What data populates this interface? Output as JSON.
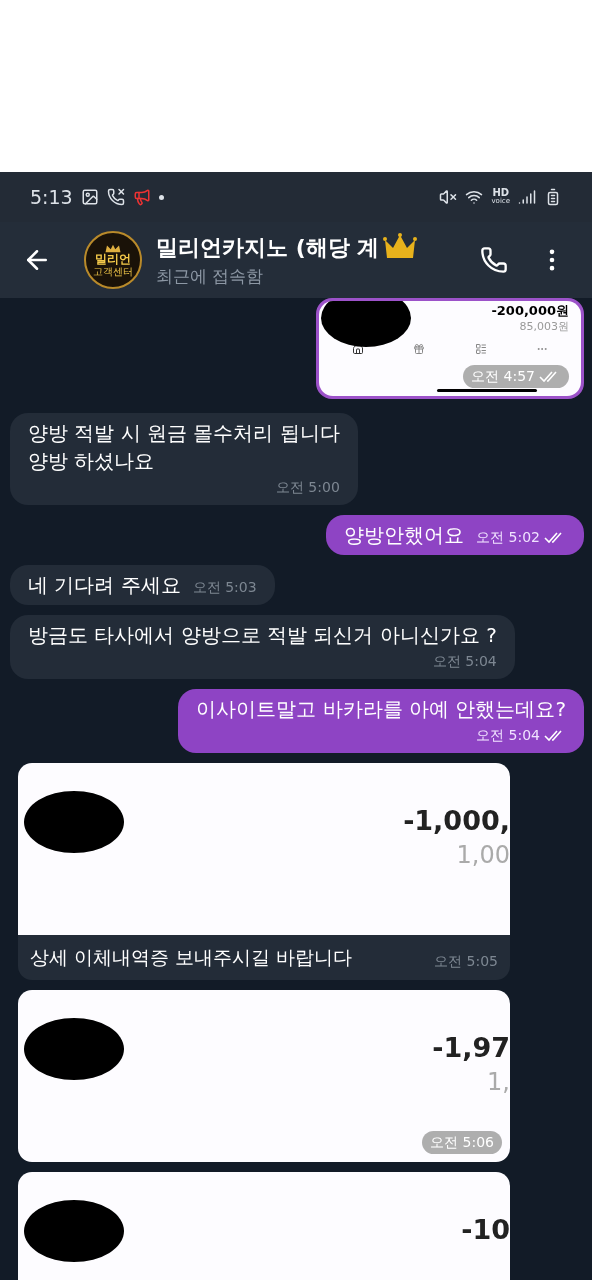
{
  "status_bar": {
    "time": "5:13",
    "hd": "HD",
    "voice": "voice"
  },
  "header": {
    "avatar": {
      "line1": "밀리언",
      "line2": "고객센터"
    },
    "title": "밀리언카지노 (해당 계",
    "subtitle": "최근에 접속함"
  },
  "messages": [
    {
      "kind": "image",
      "outgoing": true,
      "read": true,
      "time": "오전 4:57",
      "amount": "-200,000원",
      "balance": "85,003원",
      "nav": true
    },
    {
      "kind": "text",
      "outgoing": false,
      "lines": [
        "양방 적발 시 원금 몰수처리 됩니다",
        "양방 하셨나요"
      ],
      "time": "오전 5:00"
    },
    {
      "kind": "text",
      "outgoing": true,
      "read": true,
      "lines": [
        "양방안했어요"
      ],
      "time": "오전 5:02"
    },
    {
      "kind": "text",
      "outgoing": false,
      "lines": [
        "네 기다려 주세요"
      ],
      "time": "오전 5:03"
    },
    {
      "kind": "text",
      "outgoing": false,
      "lines": [
        "방금도 타사에서 양방으로 적발 되신거 아니신가요 ?"
      ],
      "time": "오전 5:04"
    },
    {
      "kind": "text",
      "outgoing": true,
      "read": true,
      "lines": [
        "이사이트말고 바카라를 아예 안했는데요?"
      ],
      "time": "오전 5:04"
    },
    {
      "kind": "image",
      "outgoing": false,
      "amount": "-1,000,",
      "balance": "1,00",
      "caption": "상세 이체내역증 보내주시길 바랍니다",
      "time": "오전 5:05"
    },
    {
      "kind": "image",
      "outgoing": false,
      "amount": "-1,97",
      "balance": "1,",
      "time": "오전 5:06"
    },
    {
      "kind": "image",
      "outgoing": false,
      "amount": "-10"
    }
  ]
}
